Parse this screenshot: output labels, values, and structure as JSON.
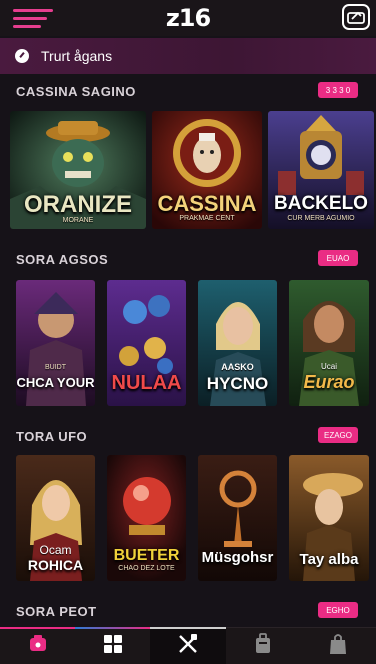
{
  "header": {
    "logo": "z16",
    "menu_icon": "hamburger-icon",
    "right_icon": "wallet-icon",
    "accent": "#e63e8f"
  },
  "search": {
    "icon": "compass-icon",
    "placeholder": "Trurt ågans"
  },
  "sections": [
    {
      "title": "CASSINA SAGINO",
      "badge": "3 3 3 0",
      "games": [
        {
          "title": "ORANIZE",
          "sub": "MORANE"
        },
        {
          "title": "CASSINA",
          "sub": "PRAKMAE CENT"
        },
        {
          "title": "BACKELO",
          "sub": "CUR MERB AGUMIO"
        }
      ]
    },
    {
      "title": "SORA AGSOS",
      "badge": "EUAO",
      "games": [
        {
          "title": "CHCA YOUR",
          "sub": "BUIDT"
        },
        {
          "title": "NULAA",
          "sub": ""
        },
        {
          "title": "HYCNO",
          "sub": "AASKO"
        },
        {
          "title": "Eurao",
          "sub": "Ucai"
        }
      ]
    },
    {
      "title": "TORA UFO",
      "badge": "EZAGO",
      "games": [
        {
          "title": "ROHICA",
          "sub": "Ocam"
        },
        {
          "title": "BUETER",
          "sub": "CHAO DEZ LOTE"
        },
        {
          "title": "Müsgohsr",
          "sub": ""
        },
        {
          "title": "Tay alba",
          "sub": ""
        }
      ]
    },
    {
      "title": "SORA PEOT",
      "badge": "EGHO"
    }
  ],
  "bottom_nav": [
    {
      "icon": "tag-icon"
    },
    {
      "icon": "grid-icon"
    },
    {
      "icon": "crossed-tools-icon"
    },
    {
      "icon": "luggage-icon"
    },
    {
      "icon": "bag-icon"
    }
  ]
}
